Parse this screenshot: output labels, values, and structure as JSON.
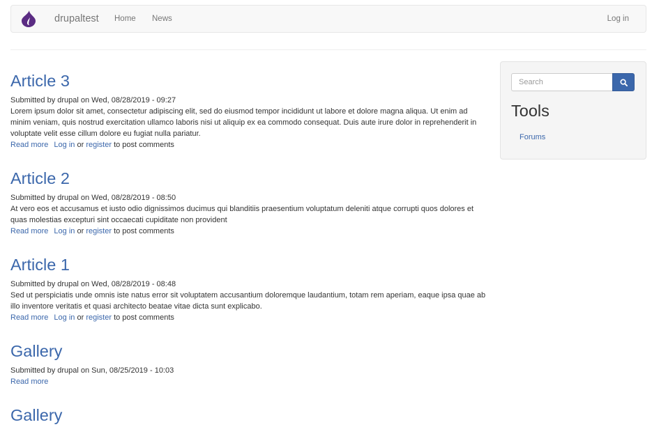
{
  "navbar": {
    "brand": "drupaltest",
    "home_label": "Home",
    "news_label": "News",
    "login_label": "Log in"
  },
  "articles": [
    {
      "title": "Article 3",
      "submitted": "Submitted by drupal on Wed, 08/28/2019 - 09:27",
      "body": "Lorem ipsum dolor sit amet, consectetur adipiscing elit, sed do eiusmod tempor incididunt ut labore et dolore magna aliqua. Ut enim ad minim veniam, quis nostrud exercitation ullamco laboris nisi ut aliquip ex ea commodo consequat. Duis aute irure dolor in reprehenderit in voluptate velit esse cillum dolore eu fugiat nulla pariatur.",
      "read_more": "Read more",
      "login": "Log in",
      "or": "or",
      "register": "register",
      "post_comments": "to post comments"
    },
    {
      "title": "Article 2",
      "submitted": "Submitted by drupal on Wed, 08/28/2019 - 08:50",
      "body": "At vero eos et accusamus et iusto odio dignissimos ducimus qui blanditiis praesentium voluptatum deleniti atque corrupti quos dolores et quas molestias excepturi sint occaecati cupiditate non provident",
      "read_more": "Read more",
      "login": "Log in",
      "or": "or",
      "register": "register",
      "post_comments": "to post comments"
    },
    {
      "title": "Article 1",
      "submitted": "Submitted by drupal on Wed, 08/28/2019 - 08:48",
      "body": "Sed ut perspiciatis unde omnis iste natus error sit voluptatem accusantium doloremque laudantium, totam rem aperiam, eaque ipsa quae ab illo inventore veritatis et quasi architecto beatae vitae dicta sunt explicabo.",
      "read_more": "Read more",
      "login": "Log in",
      "or": "or",
      "register": "register",
      "post_comments": "to post comments"
    },
    {
      "title": "Gallery",
      "submitted": "Submitted by drupal on Sun, 08/25/2019 - 10:03",
      "read_more": "Read more"
    },
    {
      "title": "Gallery"
    }
  ],
  "sidebar": {
    "search_placeholder": "Search",
    "search_icon": "search-icon",
    "tools_title": "Tools",
    "forums_label": "Forums"
  },
  "colors": {
    "link": "#3b67ab",
    "navbar_bg": "#f8f8f8",
    "text": "#333333",
    "muted": "#777777",
    "logo": "#5b2c83"
  }
}
